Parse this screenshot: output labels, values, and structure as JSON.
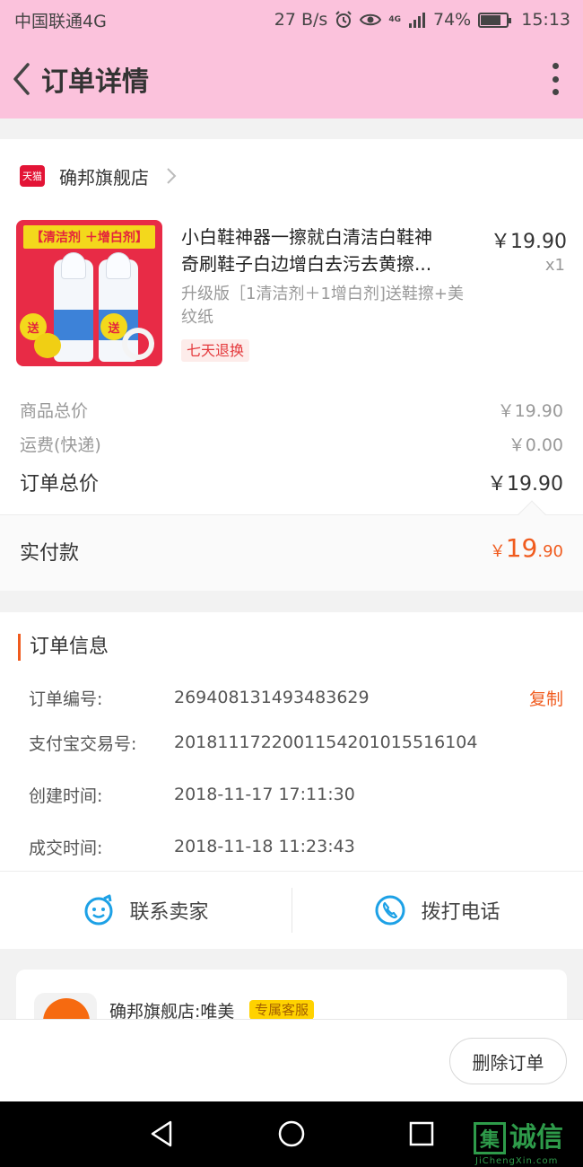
{
  "statusbar": {
    "carrier": "中国联通4G",
    "speed": "27 B/s",
    "network": "4G",
    "battery": "74%",
    "time": "15:13"
  },
  "nav": {
    "title": "订单详情"
  },
  "shop": {
    "name": "确邦旗舰店",
    "platform_badge": "天猫"
  },
  "product": {
    "title_line1": "小白鞋神器一擦就白清洁白鞋神",
    "title_line2": "奇刷鞋子白边增白去污去黄擦...",
    "price": "￥19.90",
    "qty": "x1",
    "spec": "升级版［1清洁剂＋1增白剂]送鞋擦+美纹纸",
    "tag": "七天退换",
    "image_banner": "【清洁剂 ＋增白剂】",
    "image_gift": "送"
  },
  "fees": {
    "goods_label": "商品总价",
    "goods_value": "￥19.90",
    "shipping_label": "运费(快递)",
    "shipping_value": "￥0.00",
    "total_label": "订单总价",
    "total_value": "￥19.90"
  },
  "paid": {
    "label": "实付款",
    "currency": "￥",
    "integer": "19",
    "decimal": ".90"
  },
  "order_info": {
    "title": "订单信息",
    "rows": [
      {
        "label": "订单编号:",
        "value": "269408131493483629"
      },
      {
        "label": "支付宝交易号:",
        "value": "2018111722001154201015516104"
      },
      {
        "label": "创建时间:",
        "value": "2018-11-17 17:11:30"
      },
      {
        "label": "成交时间:",
        "value": "2018-11-18 11:23:43"
      }
    ],
    "copy_label": "复制"
  },
  "contact": {
    "seller_label": "联系卖家",
    "call_label": "拨打电话"
  },
  "customer_service": {
    "name": "确邦旗舰店:唯美",
    "badge": "专属客服"
  },
  "actions": {
    "delete_label": "删除订单"
  },
  "watermark": {
    "text": "诚信",
    "box": "集",
    "sub": "JiChengXin.com"
  },
  "colors": {
    "header_bg": "#fbc2dc",
    "accent_orange": "#f05b1e",
    "tmall_red": "#e31436",
    "icon_blue": "#1da1e6"
  }
}
